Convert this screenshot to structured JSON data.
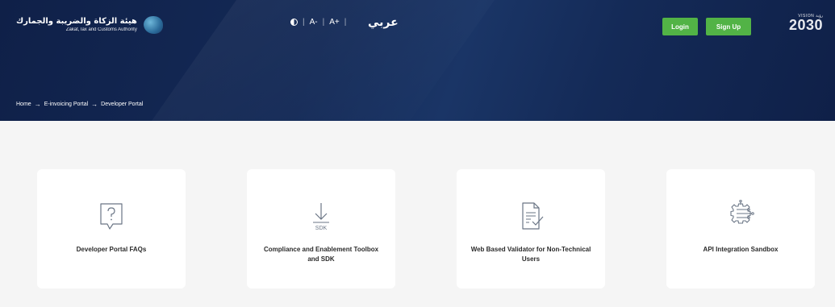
{
  "header": {
    "logo": {
      "arabic_name": "هيئة الزكاة والضريبة والجمارك",
      "english_name": "Zakat,Tax and Customs Authority"
    },
    "accessibility": {
      "decrease_font": "A-",
      "increase_font": "A+"
    },
    "language_toggle": "عربي",
    "login_label": "Login",
    "signup_label": "Sign Up",
    "vision": {
      "top": "VISION رؤية",
      "number": "2030"
    },
    "colors": {
      "header_bg": "#142a57",
      "button_bg": "#52b346"
    }
  },
  "breadcrumb": {
    "items": [
      "Home",
      "E-invoicing Portal",
      "Developer Portal"
    ],
    "separator": "→"
  },
  "cards": [
    {
      "icon": "faq-speech-bubble-icon",
      "label": "Developer Portal FAQs"
    },
    {
      "icon": "sdk-download-icon",
      "label": "Compliance and Enablement Toolbox and SDK",
      "icon_text": "SDK"
    },
    {
      "icon": "document-check-icon",
      "label": "Web Based Validator for Non-Technical Users"
    },
    {
      "icon": "api-gear-icon",
      "label": "API Integration Sandbox"
    }
  ]
}
